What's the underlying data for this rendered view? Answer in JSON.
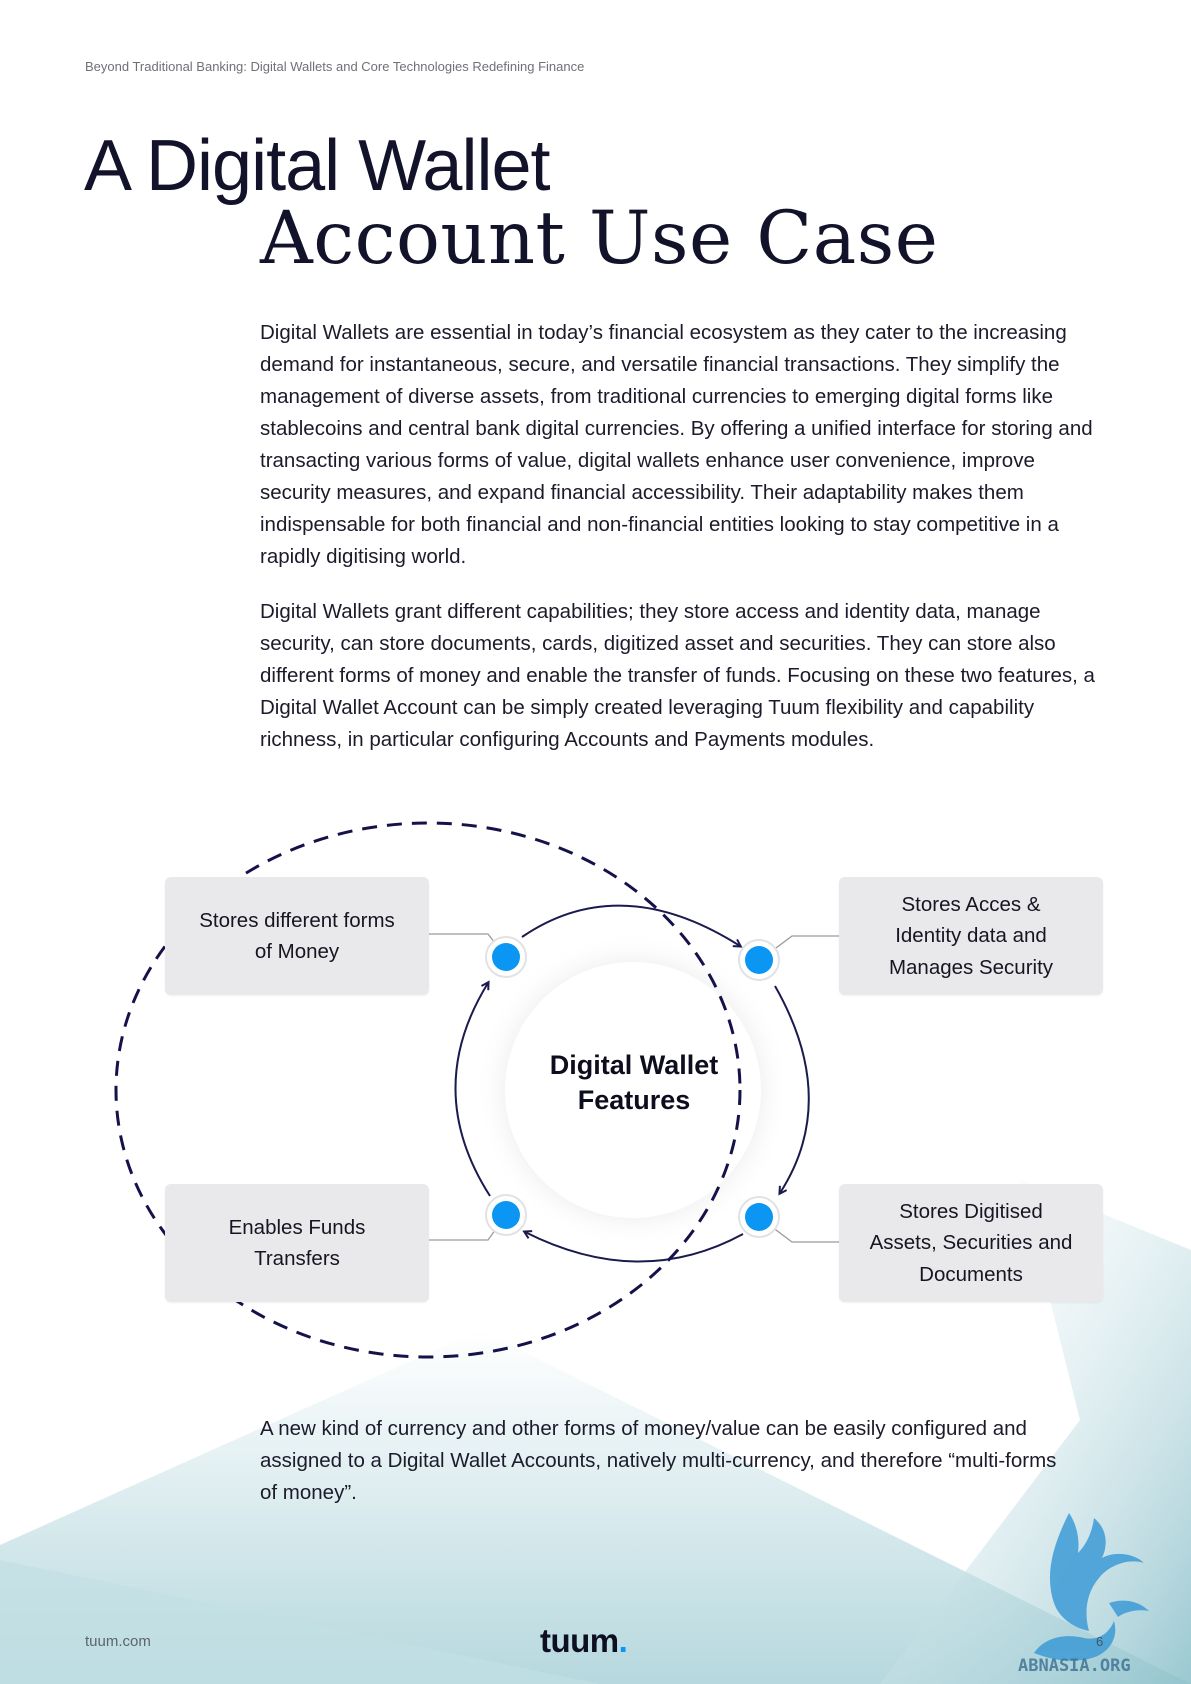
{
  "header": {
    "running_head": "Beyond Traditional Banking: Digital Wallets and Core Technologies Redefining Finance"
  },
  "title": {
    "line1": "A Digital Wallet",
    "line2": "Account Use Case"
  },
  "body": {
    "paragraph1": "Digital Wallets are essential in today’s financial ecosystem as they cater to the increasing demand for instantaneous, secure, and versatile financial transactions. They simplify the management of diverse assets, from traditional currencies to emerging digital forms like stablecoins and central bank digital currencies. By offering a unified interface for storing and transacting various forms of value, digital wallets enhance user convenience, improve security measures, and expand financial accessibility. Their adaptability makes them indispensable for both financial and non-financial entities looking to stay competitive in a rapidly digitising world.",
    "paragraph2": "Digital Wallets grant different capabilities; they store access and identity data, manage security, can store documents, cards, digitized asset and securities. They can store also different forms of money and enable the transfer of funds. Focusing on these two features, a Digital Wallet Account can be simply created leveraging Tuum flexibility and capability richness, in particular configuring Accounts and Payments modules.",
    "paragraph3": "A new kind of currency and other forms of money/value can be easily configured and assigned to a Digital Wallet Accounts, natively multi-currency, and therefore “multi-forms of money”."
  },
  "diagram": {
    "center_label": "Digital Wallet Features",
    "features": {
      "top_left": "Stores different forms of Money",
      "top_right": "Stores Acces & Identity data and Manages Security",
      "bottom_left": "Enables Funds Transfers",
      "bottom_right": "Stores Digitised Assets, Securities and Documents"
    },
    "colors": {
      "node": "#0a96f2",
      "arrow": "#1a1a4e",
      "box": "#e9e9ec"
    }
  },
  "footer": {
    "url": "tuum.com",
    "logo_text": "tuum",
    "logo_dot": ".",
    "page_number": "6",
    "watermark_text": "ABNASIA.ORG"
  }
}
